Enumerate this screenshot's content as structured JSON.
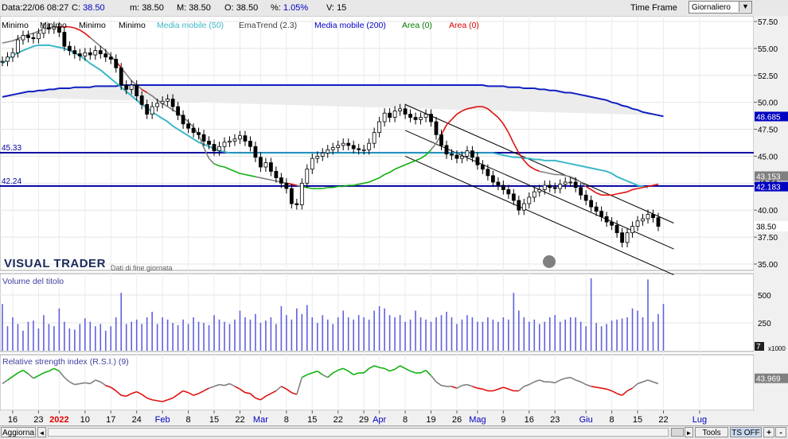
{
  "topbar": {
    "data_label": "Data:",
    "data_value": "22/06 08:27",
    "c_label": "C:",
    "c_value": "38.50",
    "m_label": "m:",
    "m_value": "38.50",
    "M_label": "M:",
    "M_value": "38.50",
    "o_label": "O:",
    "o_value": "38.50",
    "pct_label": "%:",
    "pct_value": "1.05%",
    "v_label": "V:",
    "v_value": "15",
    "timeframe_label": "Time Frame",
    "timeframe_value": "Giornaliero"
  },
  "legend": [
    {
      "label": "Minimo",
      "color": "#000000"
    },
    {
      "label": "Minimo",
      "color": "#000000"
    },
    {
      "label": "Minimo",
      "color": "#000000"
    },
    {
      "label": "Minimo",
      "color": "#000000"
    },
    {
      "label": "Media mobile (50)",
      "color": "#3cb8c8"
    },
    {
      "label": "EmaTrend (2.3)",
      "color": "#404040"
    },
    {
      "label": "Media mobile (200)",
      "color": "#0000c8"
    },
    {
      "label": "Area (0)",
      "color": "#008000"
    },
    {
      "label": "Area (0)",
      "color": "#e00000"
    }
  ],
  "watermark": {
    "brand": "VISUAL TRADER",
    "note": "Dati di fine giornata"
  },
  "colors": {
    "ma50": "#3cb8c8",
    "ma200": "#1020c0",
    "trend": "#808080",
    "up": "#10b010",
    "down": "#e01010",
    "volume": "#6060e0",
    "hline": "#0000a0",
    "channel": "#000000"
  },
  "chart_data": [
    {
      "type": "candlestick",
      "title": "",
      "ylim": [
        35.0,
        57.5
      ],
      "yticks": [
        "57.50",
        "55.00",
        "52.50",
        "50.00",
        "47.50",
        "45.00",
        "42.50",
        "40.00",
        "37.50",
        "35.00"
      ],
      "x_ticks": [
        {
          "label": "16",
          "i": 2
        },
        {
          "label": "23",
          "i": 7
        },
        {
          "label": "2022",
          "i": 11,
          "color": "#e00000"
        },
        {
          "label": "10",
          "i": 16
        },
        {
          "label": "17",
          "i": 21
        },
        {
          "label": "24",
          "i": 26
        },
        {
          "label": "Feb",
          "i": 31,
          "color": "#0000c0"
        },
        {
          "label": "8",
          "i": 36
        },
        {
          "label": "15",
          "i": 41
        },
        {
          "label": "22",
          "i": 46
        },
        {
          "label": "Mar",
          "i": 50,
          "color": "#0000c0"
        },
        {
          "label": "8",
          "i": 55
        },
        {
          "label": "15",
          "i": 60
        },
        {
          "label": "22",
          "i": 65
        },
        {
          "label": "29",
          "i": 70
        },
        {
          "label": "Apr",
          "i": 73,
          "color": "#0000c0"
        },
        {
          "label": "8",
          "i": 78
        },
        {
          "label": "19",
          "i": 83
        },
        {
          "label": "26",
          "i": 88
        },
        {
          "label": "Mag",
          "i": 92,
          "color": "#0000c0"
        },
        {
          "label": "9",
          "i": 97
        },
        {
          "label": "16",
          "i": 102
        },
        {
          "label": "23",
          "i": 107
        },
        {
          "label": "Giu",
          "i": 113,
          "color": "#0000c0"
        },
        {
          "label": "8",
          "i": 118
        },
        {
          "label": "15",
          "i": 123
        },
        {
          "label": "22",
          "i": 128
        },
        {
          "label": "Lug",
          "i": 135,
          "color": "#0000c0"
        }
      ],
      "close": [
        53.8,
        54.2,
        54.6,
        55.8,
        56.2,
        56.0,
        55.9,
        56.4,
        56.9,
        56.8,
        57.0,
        56.5,
        55.2,
        54.8,
        54.5,
        54.3,
        54.6,
        54.4,
        54.8,
        54.5,
        54.2,
        54.0,
        53.2,
        51.6,
        51.2,
        51.6,
        50.6,
        49.8,
        48.9,
        49.6,
        49.9,
        50.1,
        50.3,
        49.6,
        48.8,
        48.0,
        47.6,
        47.2,
        47.0,
        46.4,
        46.1,
        45.5,
        45.9,
        46.3,
        46.4,
        46.6,
        46.9,
        46.4,
        45.9,
        44.9,
        44.0,
        44.4,
        43.6,
        43.0,
        42.5,
        42.0,
        40.6,
        40.5,
        42.5,
        43.8,
        44.8,
        45.0,
        45.3,
        45.6,
        45.8,
        46.0,
        46.2,
        46.0,
        45.7,
        45.6,
        45.6,
        46.2,
        47.2,
        48.2,
        49.0,
        48.6,
        49.2,
        49.4,
        48.9,
        48.6,
        48.4,
        48.6,
        48.9,
        48.2,
        47.0,
        46.0,
        45.2,
        45.1,
        44.8,
        45.0,
        45.5,
        44.9,
        44.2,
        43.8,
        43.2,
        42.6,
        42.3,
        41.9,
        41.5,
        40.9,
        40.0,
        40.6,
        41.2,
        41.7,
        41.9,
        42.3,
        42.1,
        42.0,
        42.4,
        42.6,
        42.6,
        42.1,
        41.4,
        40.9,
        40.3,
        39.9,
        39.4,
        38.9,
        38.6,
        37.9,
        37.0,
        37.9,
        38.5,
        39.0,
        39.2,
        39.6,
        39.3,
        38.5
      ],
      "ma50": [
        53.6,
        54.0,
        54.3,
        54.6,
        54.8,
        55.0,
        55.2,
        55.3,
        55.3,
        55.3,
        55.2,
        55.1,
        55.0,
        54.8,
        54.6,
        54.3,
        54.0,
        53.6,
        53.3,
        53.0,
        52.6,
        52.2,
        51.8,
        51.4,
        51.0,
        50.6,
        50.2,
        49.8,
        49.5,
        49.1,
        48.8,
        48.5,
        48.2,
        47.8,
        47.5,
        47.2,
        46.9,
        46.6,
        46.3,
        46.1,
        45.9,
        45.7,
        45.5,
        45.4,
        45.3,
        45.3,
        45.3,
        45.3,
        45.3,
        45.3,
        45.3,
        45.3,
        45.3,
        45.3,
        45.3,
        45.3,
        45.3,
        45.3,
        45.3,
        45.3,
        45.3,
        45.3,
        45.3,
        45.3,
        45.3,
        45.3,
        45.3,
        45.3,
        45.3,
        45.3,
        45.3,
        45.3,
        45.3,
        45.3,
        45.3,
        45.3,
        45.3,
        45.3,
        45.3,
        45.3,
        45.3,
        45.3,
        45.3,
        45.3,
        45.3,
        45.3,
        45.3,
        45.3,
        45.3,
        45.3,
        45.3,
        45.3,
        45.3,
        45.3,
        45.3,
        45.3,
        45.2,
        45.1,
        45.0,
        44.9,
        44.9,
        44.8,
        44.8,
        44.7,
        44.7,
        44.6,
        44.6,
        44.6,
        44.5,
        44.4,
        44.3,
        44.2,
        44.1,
        44.0,
        43.9,
        43.8,
        43.7,
        43.6,
        43.4,
        43.1,
        42.9,
        42.7,
        42.5,
        42.3,
        42.2,
        42.1
      ],
      "ma200": [
        50.5,
        50.6,
        50.7,
        50.8,
        50.9,
        51.0,
        51.0,
        51.1,
        51.1,
        51.2,
        51.2,
        51.3,
        51.3,
        51.3,
        51.4,
        51.4,
        51.4,
        51.4,
        51.5,
        51.5,
        51.5,
        51.5,
        51.5,
        51.6,
        51.6,
        51.6,
        51.6,
        51.6,
        51.6,
        51.6,
        51.6,
        51.6,
        51.6,
        51.6,
        51.6,
        51.6,
        51.6,
        51.6,
        51.6,
        51.6,
        51.6,
        51.6,
        51.6,
        51.6,
        51.6,
        51.6,
        51.6,
        51.6,
        51.6,
        51.6,
        51.6,
        51.6,
        51.6,
        51.6,
        51.6,
        51.6,
        51.6,
        51.6,
        51.6,
        51.6,
        51.6,
        51.6,
        51.6,
        51.6,
        51.6,
        51.6,
        51.6,
        51.6,
        51.6,
        51.6,
        51.6,
        51.6,
        51.6,
        51.6,
        51.6,
        51.6,
        51.6,
        51.6,
        51.6,
        51.6,
        51.6,
        51.6,
        51.6,
        51.6,
        51.6,
        51.6,
        51.6,
        51.6,
        51.6,
        51.6,
        51.6,
        51.6,
        51.6,
        51.6,
        51.5,
        51.5,
        51.5,
        51.5,
        51.4,
        51.4,
        51.4,
        51.3,
        51.3,
        51.3,
        51.2,
        51.2,
        51.1,
        51.1,
        51.0,
        50.9,
        50.9,
        50.8,
        50.7,
        50.6,
        50.5,
        50.4,
        50.3,
        50.2,
        50.0,
        49.9,
        49.7,
        49.6,
        49.4,
        49.3,
        49.1,
        49.0,
        48.9,
        48.8,
        48.7
      ],
      "trend": [
        55.5,
        55.6,
        55.7,
        55.9,
        56.1,
        56.3,
        56.4,
        56.6,
        56.8,
        56.9,
        57.0,
        57.0,
        57.0,
        57.0,
        56.9,
        56.7,
        56.4,
        56.0,
        55.6,
        55.2,
        54.8,
        54.3,
        53.8,
        53.2,
        52.6,
        52.0,
        51.6,
        51.2,
        50.9,
        50.6,
        50.2,
        49.9,
        49.6,
        49.3,
        49.0,
        48.6,
        48.2,
        47.7,
        47.0,
        45.8,
        44.8,
        44.3,
        44.1,
        44.0,
        43.8,
        43.6,
        43.4,
        43.3,
        43.2,
        43.1,
        43.0,
        42.9,
        42.8,
        42.7,
        42.6,
        42.5,
        42.4,
        42.3,
        42.2,
        42.1,
        42.0,
        42.0,
        42.0,
        42.1,
        42.1,
        42.2,
        42.2,
        42.3,
        42.3,
        42.4,
        42.5,
        42.6,
        42.8,
        43.0,
        43.3,
        43.5,
        43.8,
        44.0,
        44.2,
        44.4,
        44.6,
        44.8,
        45.1,
        45.6,
        46.2,
        47.0,
        47.9,
        48.4,
        48.9,
        49.2,
        49.4,
        49.5,
        49.6,
        49.6,
        49.4,
        49.0,
        48.6,
        48.0,
        47.2,
        46.2,
        45.3,
        44.6,
        44.1,
        43.8,
        43.6,
        43.5,
        43.4,
        43.3,
        43.3,
        43.2,
        43.1,
        42.9,
        42.6,
        42.2,
        41.9,
        41.6,
        41.4,
        41.4,
        41.4,
        41.5,
        41.6,
        41.7,
        41.9,
        42.0,
        42.1,
        42.2,
        42.3,
        42.4
      ],
      "hlines": [
        {
          "value": 45.33,
          "label": "45.33"
        },
        {
          "value": 42.24,
          "label": "42.24"
        }
      ],
      "right_labels": [
        {
          "value": 48.685,
          "text": "48.685",
          "bg": "#0000c0"
        },
        {
          "value": 43.153,
          "text": "43.153",
          "bg": "#808080"
        },
        {
          "value": 42.183,
          "text": "42.183",
          "bg": "#0000c0"
        },
        {
          "value": 38.5,
          "text": "38.50",
          "bg": "#ffffff"
        }
      ]
    },
    {
      "type": "bar",
      "title": "Volume del titolo",
      "yticks": [
        "500",
        "250"
      ],
      "ylim": [
        0,
        650
      ],
      "unit": "x1000",
      "values": [
        420,
        220,
        300,
        240,
        180,
        260,
        270,
        200,
        320,
        240,
        220,
        380,
        260,
        200,
        190,
        240,
        290,
        260,
        220,
        240,
        180,
        220,
        300,
        520,
        240,
        260,
        280,
        240,
        300,
        350,
        240,
        300,
        280,
        250,
        230,
        280,
        240,
        300,
        260,
        250,
        230,
        320,
        280,
        260,
        240,
        280,
        360,
        300,
        280,
        330,
        250,
        270,
        300,
        240,
        400,
        320,
        280,
        380,
        330,
        410,
        300,
        250,
        320,
        280,
        240,
        300,
        360,
        300,
        280,
        320,
        300,
        280,
        360,
        400,
        380,
        320,
        300,
        320,
        260,
        280,
        360,
        300,
        280,
        260,
        300,
        320,
        350,
        300,
        240,
        280,
        320,
        300,
        260,
        260,
        300,
        280,
        260,
        300,
        280,
        520,
        360,
        300,
        260,
        280,
        240,
        260,
        300,
        320,
        260,
        280,
        300,
        300,
        260,
        220,
        650,
        250,
        220,
        240,
        270,
        280,
        290,
        300,
        380,
        360,
        300,
        640,
        260,
        330,
        420
      ]
    },
    {
      "type": "line",
      "title": "Relative strength index (R.S.I.) (9)",
      "ylim": [
        0,
        100
      ],
      "last_value_label": "43.969",
      "values": [
        38,
        42,
        46,
        50,
        53,
        49,
        44,
        47,
        50,
        52,
        55,
        52,
        45,
        40,
        37,
        38,
        39,
        38,
        42,
        40,
        36,
        34,
        30,
        25,
        24,
        27,
        29,
        26,
        22,
        20,
        19,
        18,
        20,
        22,
        26,
        30,
        28,
        25,
        27,
        30,
        33,
        35,
        37,
        36,
        38,
        35,
        32,
        28,
        27,
        22,
        20,
        24,
        27,
        30,
        35,
        32,
        28,
        26,
        45,
        48,
        50,
        52,
        48,
        45,
        50,
        53,
        55,
        52,
        48,
        50,
        50,
        55,
        58,
        56,
        55,
        52,
        54,
        58,
        55,
        52,
        50,
        50,
        53,
        47,
        40,
        36,
        35,
        35,
        33,
        36,
        37,
        35,
        33,
        32,
        30,
        30,
        32,
        34,
        32,
        30,
        30,
        35,
        37,
        40,
        42,
        40,
        40,
        39,
        42,
        44,
        45,
        42,
        40,
        37,
        35,
        34,
        33,
        32,
        30,
        27,
        25,
        30,
        33,
        38,
        40,
        42,
        40,
        38
      ]
    }
  ],
  "bottombar": {
    "refresh_label": "Aggiorna",
    "tools_label": "Tools",
    "ts_label": "TS OFF",
    "plus_label": "+",
    "minus_label": "-"
  }
}
